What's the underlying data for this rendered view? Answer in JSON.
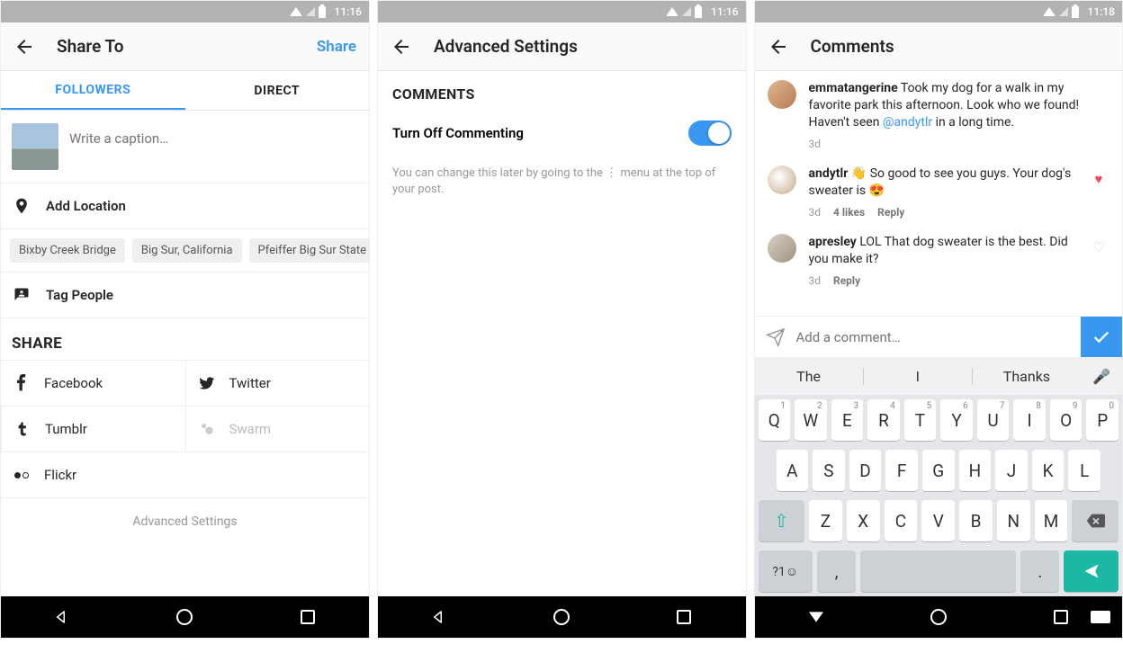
{
  "statusTime1": "11:16",
  "statusTime2": "11:16",
  "statusTime3": "11:18",
  "p1": {
    "title": "Share To",
    "action": "Share",
    "tabs": {
      "followers": "FOLLOWERS",
      "direct": "DIRECT"
    },
    "caption_placeholder": "Write a caption…",
    "addLocation": "Add Location",
    "chips": [
      "Bixby Creek Bridge",
      "Big Sur, California",
      "Pfeiffer Big Sur State P…"
    ],
    "tagPeople": "Tag People",
    "shareHdr": "SHARE",
    "fb": "Facebook",
    "tw": "Twitter",
    "tumblr": "Tumblr",
    "swarm": "Swarm",
    "flickr": "Flickr",
    "advanced": "Advanced Settings"
  },
  "p2": {
    "title": "Advanced Settings",
    "commentsHdr": "COMMENTS",
    "toggleLabel": "Turn Off Commenting",
    "note": "You can change this later by going to the ⋮ menu at the top of your post."
  },
  "p3": {
    "title": "Comments",
    "c1": {
      "user": "emmatangerine",
      "text": " Took my dog for a walk in my favorite park this afternoon. Look who we found! Haven't seen ",
      "mention": "@andytlr",
      "tail": " in a long time.",
      "time": "3d"
    },
    "c2": {
      "user": "andytlr",
      "text": " 👋 So good to see you guys. Your dog's sweater is 😍",
      "time": "3d",
      "likes": "4 likes",
      "reply": "Reply"
    },
    "c3": {
      "user": "apresley",
      "text": " LOL That dog sweater is the best. Did you make it?",
      "time": "3d",
      "reply": "Reply"
    },
    "compose_placeholder": "Add a comment…",
    "suggest": [
      "The",
      "I",
      "Thanks"
    ],
    "row1": [
      {
        "k": "Q",
        "n": "1"
      },
      {
        "k": "W",
        "n": "2"
      },
      {
        "k": "E",
        "n": "3"
      },
      {
        "k": "R",
        "n": "4"
      },
      {
        "k": "T",
        "n": "5"
      },
      {
        "k": "Y",
        "n": "6"
      },
      {
        "k": "U",
        "n": "7"
      },
      {
        "k": "I",
        "n": "8"
      },
      {
        "k": "O",
        "n": "9"
      },
      {
        "k": "P",
        "n": "0"
      }
    ],
    "row2": [
      "A",
      "S",
      "D",
      "F",
      "G",
      "H",
      "J",
      "K",
      "L"
    ],
    "row3": [
      "Z",
      "X",
      "C",
      "V",
      "B",
      "N",
      "M"
    ],
    "symKey": "?1☺",
    "commaKey": ",",
    "dotKey": "."
  }
}
